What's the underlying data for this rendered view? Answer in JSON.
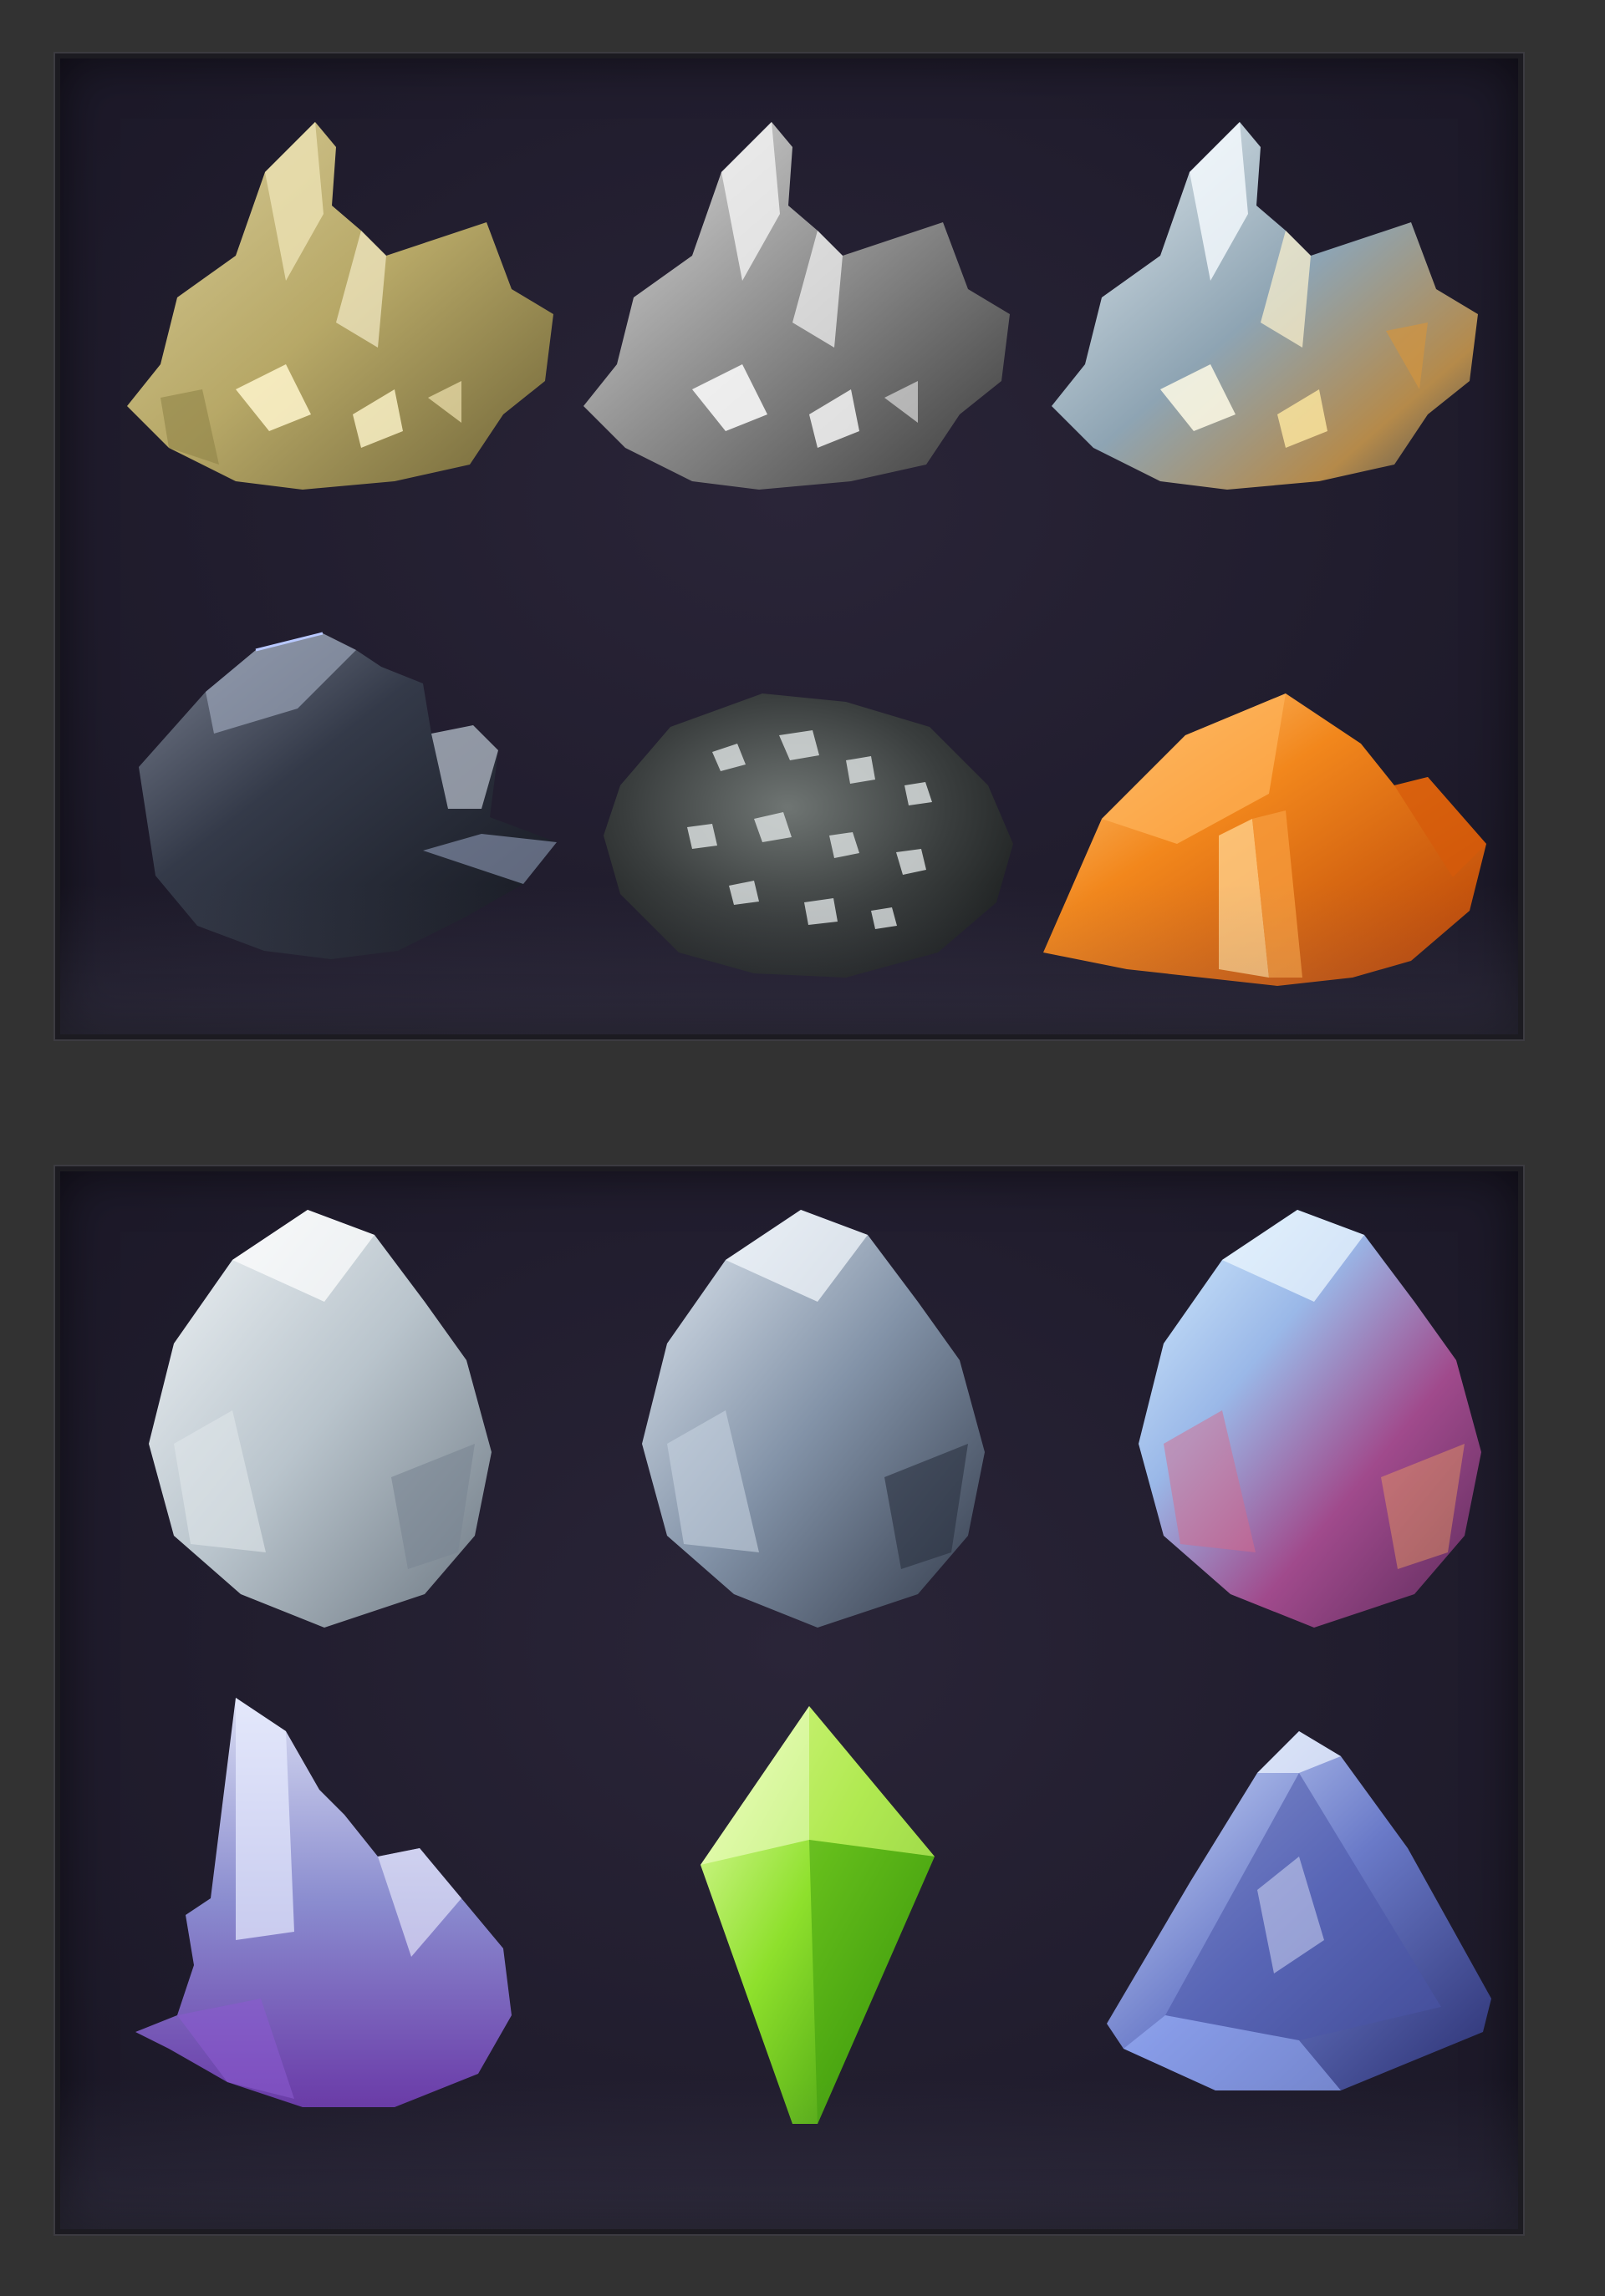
{
  "colors": {
    "background": "#323232",
    "panel": "#221e30",
    "panel_border": "#1c1b21"
  },
  "panels": [
    {
      "items": [
        {
          "icon": "gold-crystal-cluster-icon"
        },
        {
          "icon": "silver-crystal-cluster-icon"
        },
        {
          "icon": "pale-blue-crystal-cluster-icon"
        },
        {
          "icon": "dark-metal-ore-icon"
        },
        {
          "icon": "speckled-rock-ore-icon"
        },
        {
          "icon": "orange-crystal-cluster-icon"
        }
      ]
    },
    {
      "items": [
        {
          "icon": "white-gem-icon"
        },
        {
          "icon": "steel-blue-gem-icon"
        },
        {
          "icon": "iridescent-purple-gem-icon"
        },
        {
          "icon": "amethyst-crystal-cluster-icon"
        },
        {
          "icon": "green-diamond-crystal-icon"
        },
        {
          "icon": "blue-trillion-gem-icon"
        }
      ]
    }
  ]
}
